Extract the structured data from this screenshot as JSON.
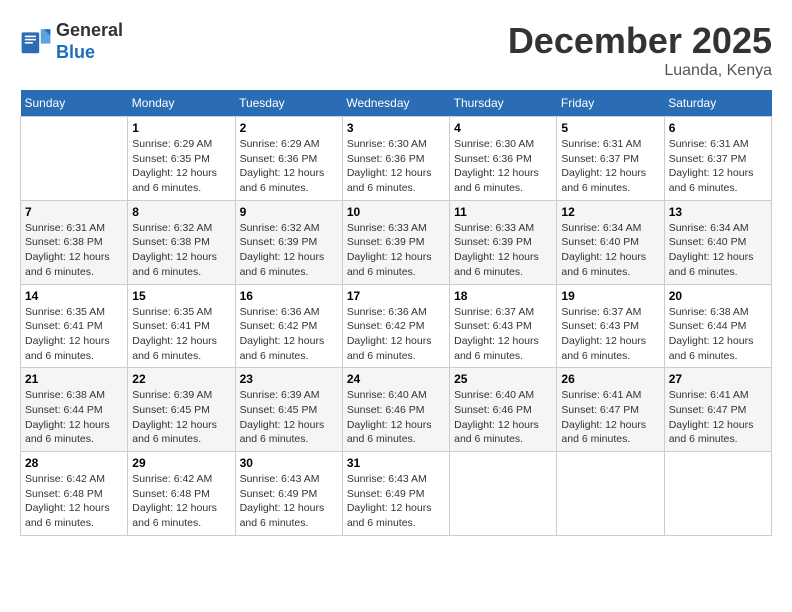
{
  "header": {
    "logo_line1": "General",
    "logo_line2": "Blue",
    "month_title": "December 2025",
    "location": "Luanda, Kenya"
  },
  "days_of_week": [
    "Sunday",
    "Monday",
    "Tuesday",
    "Wednesday",
    "Thursday",
    "Friday",
    "Saturday"
  ],
  "weeks": [
    [
      {
        "day": "",
        "info": ""
      },
      {
        "day": "1",
        "info": "Sunrise: 6:29 AM\nSunset: 6:35 PM\nDaylight: 12 hours and 6 minutes."
      },
      {
        "day": "2",
        "info": "Sunrise: 6:29 AM\nSunset: 6:36 PM\nDaylight: 12 hours and 6 minutes."
      },
      {
        "day": "3",
        "info": "Sunrise: 6:30 AM\nSunset: 6:36 PM\nDaylight: 12 hours and 6 minutes."
      },
      {
        "day": "4",
        "info": "Sunrise: 6:30 AM\nSunset: 6:36 PM\nDaylight: 12 hours and 6 minutes."
      },
      {
        "day": "5",
        "info": "Sunrise: 6:31 AM\nSunset: 6:37 PM\nDaylight: 12 hours and 6 minutes."
      },
      {
        "day": "6",
        "info": "Sunrise: 6:31 AM\nSunset: 6:37 PM\nDaylight: 12 hours and 6 minutes."
      }
    ],
    [
      {
        "day": "7",
        "info": "Sunrise: 6:31 AM\nSunset: 6:38 PM\nDaylight: 12 hours and 6 minutes."
      },
      {
        "day": "8",
        "info": "Sunrise: 6:32 AM\nSunset: 6:38 PM\nDaylight: 12 hours and 6 minutes."
      },
      {
        "day": "9",
        "info": "Sunrise: 6:32 AM\nSunset: 6:39 PM\nDaylight: 12 hours and 6 minutes."
      },
      {
        "day": "10",
        "info": "Sunrise: 6:33 AM\nSunset: 6:39 PM\nDaylight: 12 hours and 6 minutes."
      },
      {
        "day": "11",
        "info": "Sunrise: 6:33 AM\nSunset: 6:39 PM\nDaylight: 12 hours and 6 minutes."
      },
      {
        "day": "12",
        "info": "Sunrise: 6:34 AM\nSunset: 6:40 PM\nDaylight: 12 hours and 6 minutes."
      },
      {
        "day": "13",
        "info": "Sunrise: 6:34 AM\nSunset: 6:40 PM\nDaylight: 12 hours and 6 minutes."
      }
    ],
    [
      {
        "day": "14",
        "info": "Sunrise: 6:35 AM\nSunset: 6:41 PM\nDaylight: 12 hours and 6 minutes."
      },
      {
        "day": "15",
        "info": "Sunrise: 6:35 AM\nSunset: 6:41 PM\nDaylight: 12 hours and 6 minutes."
      },
      {
        "day": "16",
        "info": "Sunrise: 6:36 AM\nSunset: 6:42 PM\nDaylight: 12 hours and 6 minutes."
      },
      {
        "day": "17",
        "info": "Sunrise: 6:36 AM\nSunset: 6:42 PM\nDaylight: 12 hours and 6 minutes."
      },
      {
        "day": "18",
        "info": "Sunrise: 6:37 AM\nSunset: 6:43 PM\nDaylight: 12 hours and 6 minutes."
      },
      {
        "day": "19",
        "info": "Sunrise: 6:37 AM\nSunset: 6:43 PM\nDaylight: 12 hours and 6 minutes."
      },
      {
        "day": "20",
        "info": "Sunrise: 6:38 AM\nSunset: 6:44 PM\nDaylight: 12 hours and 6 minutes."
      }
    ],
    [
      {
        "day": "21",
        "info": "Sunrise: 6:38 AM\nSunset: 6:44 PM\nDaylight: 12 hours and 6 minutes."
      },
      {
        "day": "22",
        "info": "Sunrise: 6:39 AM\nSunset: 6:45 PM\nDaylight: 12 hours and 6 minutes."
      },
      {
        "day": "23",
        "info": "Sunrise: 6:39 AM\nSunset: 6:45 PM\nDaylight: 12 hours and 6 minutes."
      },
      {
        "day": "24",
        "info": "Sunrise: 6:40 AM\nSunset: 6:46 PM\nDaylight: 12 hours and 6 minutes."
      },
      {
        "day": "25",
        "info": "Sunrise: 6:40 AM\nSunset: 6:46 PM\nDaylight: 12 hours and 6 minutes."
      },
      {
        "day": "26",
        "info": "Sunrise: 6:41 AM\nSunset: 6:47 PM\nDaylight: 12 hours and 6 minutes."
      },
      {
        "day": "27",
        "info": "Sunrise: 6:41 AM\nSunset: 6:47 PM\nDaylight: 12 hours and 6 minutes."
      }
    ],
    [
      {
        "day": "28",
        "info": "Sunrise: 6:42 AM\nSunset: 6:48 PM\nDaylight: 12 hours and 6 minutes."
      },
      {
        "day": "29",
        "info": "Sunrise: 6:42 AM\nSunset: 6:48 PM\nDaylight: 12 hours and 6 minutes."
      },
      {
        "day": "30",
        "info": "Sunrise: 6:43 AM\nSunset: 6:49 PM\nDaylight: 12 hours and 6 minutes."
      },
      {
        "day": "31",
        "info": "Sunrise: 6:43 AM\nSunset: 6:49 PM\nDaylight: 12 hours and 6 minutes."
      },
      {
        "day": "",
        "info": ""
      },
      {
        "day": "",
        "info": ""
      },
      {
        "day": "",
        "info": ""
      }
    ]
  ]
}
